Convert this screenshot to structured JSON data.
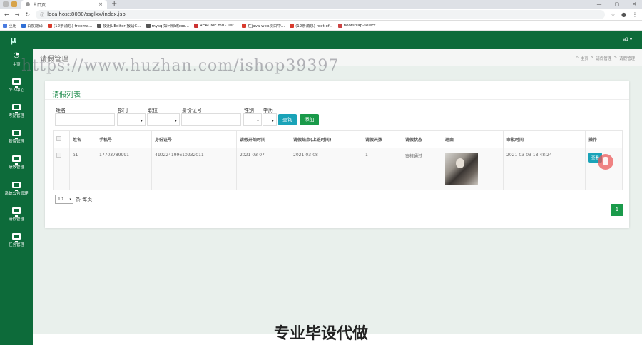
{
  "browser": {
    "tab_title": "人口页",
    "url": "localhost:8080/ssglxx/index.jsp",
    "bookmarks": [
      "应用",
      "百度翻译",
      "(12条消息) freema...",
      "使用UEditor 报错C...",
      "mysql如何修改roo...",
      "README.md · Ter...",
      "在java web项目中...",
      "(12条消息) root of...",
      "bootstrap-select..."
    ]
  },
  "app": {
    "brand": "μ",
    "user": "a1 ▾"
  },
  "sidebar": {
    "items": [
      {
        "label": "主页",
        "icon": "dashboard-icon"
      },
      {
        "label": "个人中心",
        "icon": "monitor-icon"
      },
      {
        "label": "考勤管理",
        "icon": "monitor-icon"
      },
      {
        "label": "薪资管理",
        "icon": "monitor-icon"
      },
      {
        "label": "绩效管理",
        "icon": "monitor-icon"
      },
      {
        "label": "系统公告管理",
        "icon": "monitor-icon"
      },
      {
        "label": "请假管理",
        "icon": "monitor-icon"
      },
      {
        "label": "任务管理",
        "icon": "monitor-icon"
      }
    ]
  },
  "page": {
    "title": "请假管理",
    "breadcrumb": {
      "home": "主页",
      "sep": ">",
      "level1": "请假管理",
      "level2": "请假管理"
    }
  },
  "card": {
    "title": "请假列表"
  },
  "filters": {
    "name_label": "姓名",
    "dept_label": "部门",
    "position_label": "职位",
    "idcard_label": "身份证号",
    "gender_label": "性别",
    "education_label": "学历",
    "search_button": "查询",
    "add_button": "添加"
  },
  "table": {
    "headers": [
      "姓名",
      "手机号",
      "身份证号",
      "请假开始时间",
      "请假结束(上班时间)",
      "请假天数",
      "请假状态",
      "理由",
      "审批时间",
      "操作"
    ],
    "rows": [
      {
        "name": "a1",
        "phone": "17703789991",
        "idcard": "410224199610232011",
        "start": "2021-03-07",
        "end": "2021-03-08",
        "days": "1",
        "status": "审核通过",
        "approved_at": "2021-03-03 18:48:24",
        "view_button": "查看"
      }
    ]
  },
  "pagination": {
    "page_size": "10",
    "per_page_text": "条 每页",
    "current_page": "1"
  },
  "overlay": {
    "watermark": "https://www.huzhan.com/ishop39397",
    "caption": "专业毕设代做"
  },
  "colors": {
    "primary": "#0d6b3a",
    "accent": "#1c8a4a",
    "view_button": "#1aa3b8",
    "pager": "#1a9a4a"
  }
}
